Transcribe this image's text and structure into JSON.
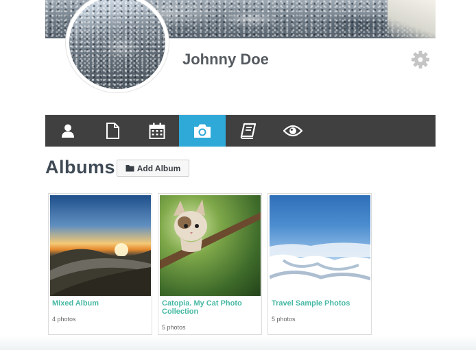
{
  "profile": {
    "name": "Johnny Doe",
    "settings_icon": "gear-icon"
  },
  "nav": {
    "tabs": [
      {
        "icon": "user-icon",
        "active": false
      },
      {
        "icon": "document-icon",
        "active": false
      },
      {
        "icon": "calendar-icon",
        "active": false
      },
      {
        "icon": "camera-icon",
        "active": true
      },
      {
        "icon": "book-icon",
        "active": false
      },
      {
        "icon": "eye-icon",
        "active": false
      }
    ],
    "active_color": "#2ea9d8",
    "bar_color": "#404040"
  },
  "albums": {
    "heading": "Albums",
    "add_button_label": "Add Album",
    "add_button_icon": "folder-icon",
    "items": [
      {
        "title": "Mixed Album",
        "count": "4 photos",
        "thumb": "mountain-road-sunset"
      },
      {
        "title": "Catopia. My Cat Photo Collection",
        "count": "5 photos",
        "thumb": "kitten-in-tree"
      },
      {
        "title": "Travel Sample Photos",
        "count": "5 photos",
        "thumb": "clouds-above-mountains"
      }
    ],
    "title_color": "#45b8a3"
  }
}
